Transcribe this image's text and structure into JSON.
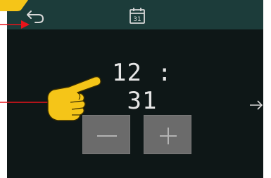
{
  "header": {
    "back_icon": "back-arrow-icon",
    "calendar_icon": "calendar-icon",
    "calendar_day": "31"
  },
  "clock": {
    "time": "12 : 31"
  },
  "controls": {
    "decrement_icon": "minus-icon",
    "increment_icon": "plus-icon",
    "next_icon": "right-arrow-icon"
  },
  "annotations": {
    "pointer_color": "#e8141b",
    "hand_color": "#f5c518",
    "badge_color": "#f5c518"
  }
}
